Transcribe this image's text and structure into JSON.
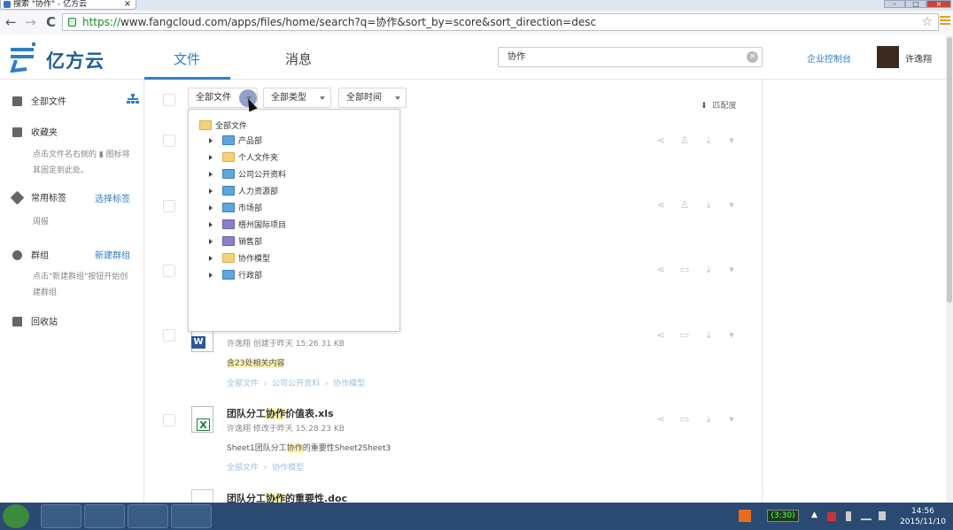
{
  "browser": {
    "tab_title": "搜索 \"协作\" - 亿方云",
    "tab_close": "×",
    "url_scheme": "https://",
    "url_rest": "www.fangcloud.com/apps/files/home/search?q=协作&sort_by=score&sort_direction=desc",
    "back": "←",
    "forward": "→",
    "reload": "C",
    "star": "☆",
    "win_min": "–",
    "win_max": "□",
    "win_close": "×"
  },
  "header": {
    "brand": "亿方云",
    "tabs": [
      "文件",
      "消息"
    ],
    "active_tab": 0,
    "search_value": "协作",
    "search_clear": "×",
    "enterprise_console": "企业控制台",
    "user_name": "许逸翔"
  },
  "sidebar": {
    "all_files": "全部文件",
    "favorites": "收藏夹",
    "favorites_hint": "点击文件名右侧的 ▮ 图标将其固定到此处。",
    "tags": "常用标签",
    "choose_tags": "选择标签",
    "tag_item": "周报",
    "groups": "群组",
    "new_group": "新建群组",
    "groups_hint": "点击\"新建群组\"按钮开始创建群组",
    "trash": "回收站"
  },
  "filters": {
    "scope": "全部文件",
    "type": "全部类型",
    "time": "全部时间",
    "sort": "匹配度",
    "sort_icon": "⬇"
  },
  "dropdown": {
    "root": "全部文件",
    "items": [
      {
        "name": "产品部",
        "kind": "team"
      },
      {
        "name": "个人文件夹",
        "kind": "folder"
      },
      {
        "name": "公司公开资料",
        "kind": "team"
      },
      {
        "name": "人力资源部",
        "kind": "team"
      },
      {
        "name": "市场部",
        "kind": "team"
      },
      {
        "name": "梧州国际项目",
        "kind": "team2"
      },
      {
        "name": "销售部",
        "kind": "team2"
      },
      {
        "name": "协作模型",
        "kind": "folder"
      },
      {
        "name": "行政部",
        "kind": "team"
      }
    ]
  },
  "files": [
    {
      "meta": "许逸翔  创建于昨天 15:26  31 KB",
      "snippet": "含23处相关内容",
      "crumb1": "全部文件",
      "crumb2": "公司公开资料",
      "crumb3": "协作模型",
      "icon": "W"
    },
    {
      "title_pre": "团队分工",
      "title_hl": "协作",
      "title_post": "价值表.xls",
      "meta": "许逸翔  修改于昨天 15:28  23 KB",
      "snippet_pre": "Sheet1团队分工",
      "snippet_hl": "协作",
      "snippet_post": "的重要性Sheet2Sheet3",
      "crumb1": "全部文件",
      "crumb2": "协作模型",
      "icon": "X"
    },
    {
      "title_pre": "团队分工",
      "title_hl": "协作",
      "title_post": "的重要性.doc"
    }
  ],
  "action_icons": {
    "share": "⋖",
    "collab": "♙",
    "comment": "▭",
    "download": "⤓",
    "more": "▾"
  },
  "taskbar": {
    "battery": "(3:30)",
    "time": "14:56",
    "date": "2015/11/10",
    "tray_up": "▲"
  },
  "colors": {
    "accent": "#2f7ec4",
    "highlight": "#fff5b3",
    "taskbar": "#2a4a72"
  }
}
